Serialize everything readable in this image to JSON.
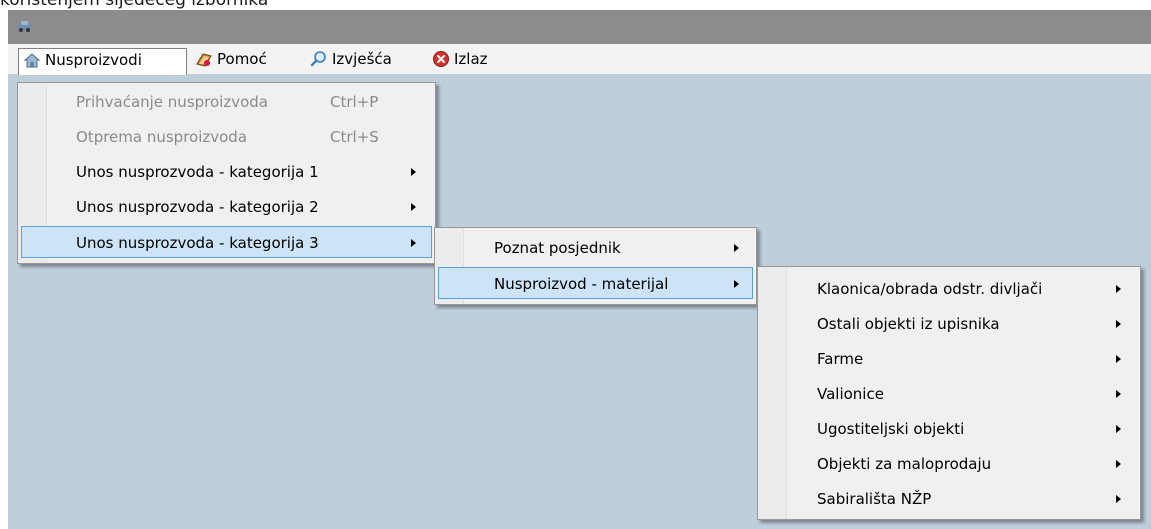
{
  "caption": "korištenjem sljedećeg izbornika",
  "menubar": [
    {
      "label": "Nusproizvodi",
      "icon": "home-icon"
    },
    {
      "label": "Pomoć",
      "icon": "help-book-icon"
    },
    {
      "label": "Izvješća",
      "icon": "magnifier-icon"
    },
    {
      "label": "Izlaz",
      "icon": "exit-icon"
    }
  ],
  "menu1": [
    {
      "label": "Prihvaćanje nusproizvoda",
      "shortcut": "Ctrl+P",
      "enabled": false
    },
    {
      "label": "Otprema nusproizvoda",
      "shortcut": "Ctrl+S",
      "enabled": false
    },
    {
      "label": "Unos nusprozvoda - kategorija 1",
      "submenu": true
    },
    {
      "label": "Unos nusprozvoda - kategorija 2",
      "submenu": true
    },
    {
      "label": "Unos nusprozvoda - kategorija 3",
      "submenu": true,
      "highlighted": true
    }
  ],
  "menu2": [
    {
      "label": "Poznat posjednik",
      "submenu": true
    },
    {
      "label": "Nusproizvod - materijal",
      "submenu": true,
      "highlighted": true
    }
  ],
  "menu3": [
    {
      "label": "Klaonica/obrada odstr. divljači",
      "submenu": true
    },
    {
      "label": "Ostali objekti iz upisnika",
      "submenu": true
    },
    {
      "label": "Farme",
      "submenu": true
    },
    {
      "label": "Valionice",
      "submenu": true
    },
    {
      "label": "Ugostiteljski objekti",
      "submenu": true
    },
    {
      "label": "Objekti za maloprodaju",
      "submenu": true
    },
    {
      "label": "Sabirališta NŽP",
      "submenu": true
    }
  ],
  "colors": {
    "window_bg": "#bfcedb",
    "titlebar": "#8c8c8c",
    "highlight": "#cde4f7",
    "highlight_border": "#5da0de"
  }
}
